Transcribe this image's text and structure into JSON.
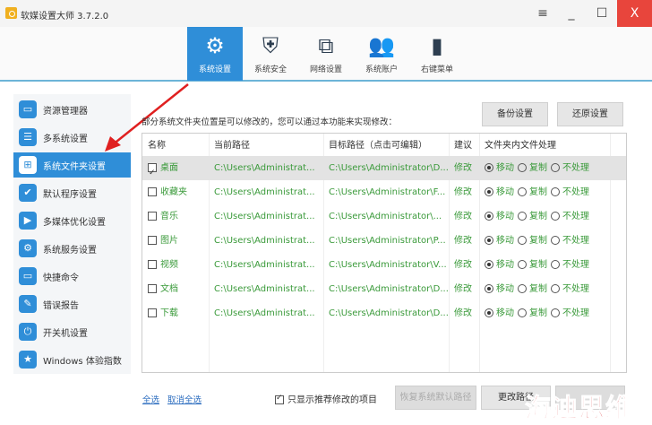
{
  "window": {
    "title": "软媒设置大师 3.7.2.0",
    "menu_icon": "≡",
    "min_icon": "_",
    "max_icon": "☐",
    "close_icon": "X"
  },
  "tabs": [
    {
      "label": "系统设置",
      "icon": "⚙"
    },
    {
      "label": "系统安全",
      "icon": "⛨"
    },
    {
      "label": "网络设置",
      "icon": "⧉"
    },
    {
      "label": "系统账户",
      "icon": "👥"
    },
    {
      "label": "右键菜单",
      "icon": "▮"
    }
  ],
  "sidebar": [
    {
      "label": "资源管理器",
      "icon": "▭"
    },
    {
      "label": "多系统设置",
      "icon": "☰"
    },
    {
      "label": "系统文件夹设置",
      "icon": "⊞"
    },
    {
      "label": "默认程序设置",
      "icon": "✔"
    },
    {
      "label": "多媒体优化设置",
      "icon": "▶"
    },
    {
      "label": "系统服务设置",
      "icon": "⚙"
    },
    {
      "label": "快捷命令",
      "icon": "▭"
    },
    {
      "label": "错误报告",
      "icon": "✎"
    },
    {
      "label": "开关机设置",
      "icon": "⏻"
    },
    {
      "label": "Windows 体验指数",
      "icon": "★"
    }
  ],
  "main": {
    "description": "部分系统文件夹位置是可以修改的，您可以通过本功能来实现修改：",
    "backup": "备份设置",
    "restore": "还原设置",
    "columns": [
      "名称",
      "当前路径",
      "目标路径（点击可编辑）",
      "建议",
      "文件夹内文件处理"
    ],
    "rows": [
      {
        "name": "桌面",
        "checked": true,
        "current": "C:\\Users\\Administrat...",
        "target": "C:\\Users\\Administrator\\D...",
        "suggest": "修改"
      },
      {
        "name": "收藏夹",
        "checked": false,
        "current": "C:\\Users\\Administrat...",
        "target": "C:\\Users\\Administrator\\F...",
        "suggest": "修改"
      },
      {
        "name": "音乐",
        "checked": false,
        "current": "C:\\Users\\Administrat...",
        "target": "C:\\Users\\Administrator\\...",
        "suggest": "修改"
      },
      {
        "name": "图片",
        "checked": false,
        "current": "C:\\Users\\Administrat...",
        "target": "C:\\Users\\Administrator\\P...",
        "suggest": "修改"
      },
      {
        "name": "视频",
        "checked": false,
        "current": "C:\\Users\\Administrat...",
        "target": "C:\\Users\\Administrator\\V...",
        "suggest": "修改"
      },
      {
        "name": "文档",
        "checked": false,
        "current": "C:\\Users\\Administrat...",
        "target": "C:\\Users\\Administrator\\D...",
        "suggest": "修改"
      },
      {
        "name": "下载",
        "checked": false,
        "current": "C:\\Users\\Administrat...",
        "target": "C:\\Users\\Administrator\\D...",
        "suggest": "修改"
      }
    ],
    "options": [
      "移动",
      "复制",
      "不处理"
    ],
    "select_all": "全选",
    "deselect_all": "取消全选",
    "only_recommended": "只显示推荐修改的项目",
    "restore_default": "恢复系统默认路径",
    "change_path": "更改路径"
  },
  "watermark": "海迪思维"
}
